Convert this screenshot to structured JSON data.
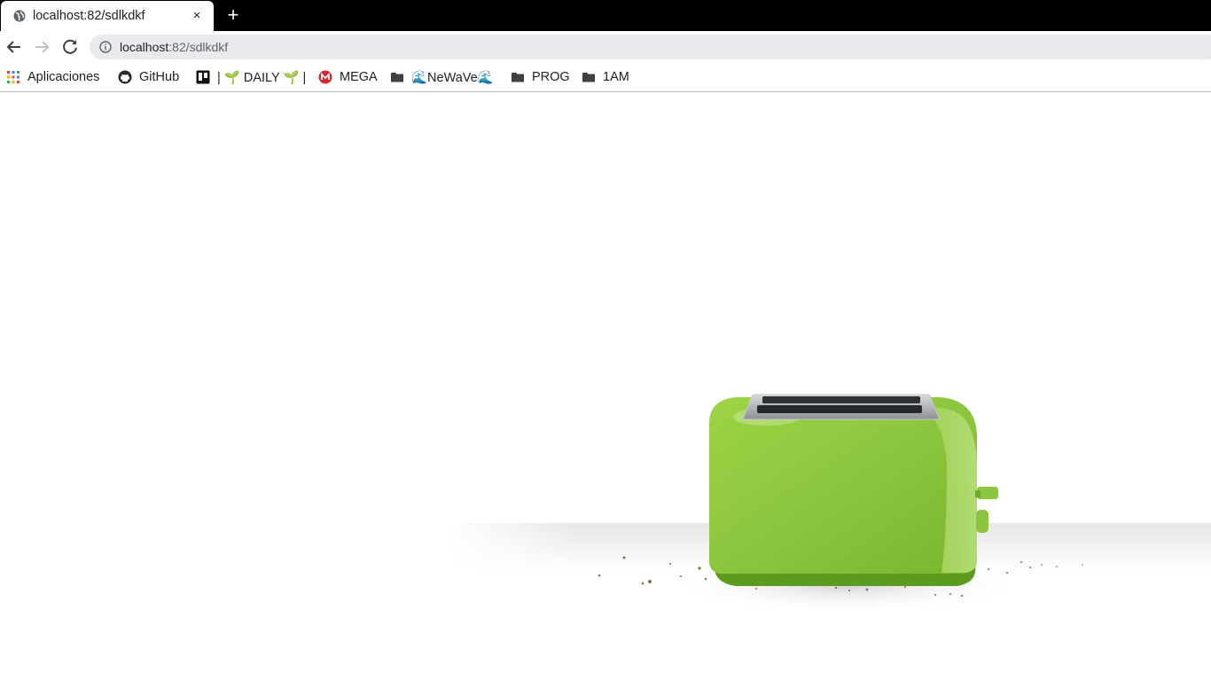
{
  "browser": {
    "tab": {
      "title": "localhost:82/sdlkdkf",
      "close_glyph": "×",
      "favicon": "globe-icon"
    },
    "new_tab_glyph": "+",
    "address": {
      "host": "localhost",
      "path": ":82/sdlkdkf"
    }
  },
  "bookmarks": [
    {
      "label": "Aplicaciones",
      "icon": "apps-grid-icon"
    },
    {
      "label": "GitHub",
      "icon": "github-icon"
    },
    {
      "label": "| 🌱 DAILY 🌱 |",
      "icon": "trello-icon"
    },
    {
      "label": "MEGA",
      "icon": "mega-icon"
    },
    {
      "label": "🌊NeWaVe🌊",
      "icon": "folder-icon"
    },
    {
      "label": "PROG",
      "icon": "folder-icon"
    },
    {
      "label": "1AM",
      "icon": "folder-icon"
    }
  ],
  "page": {
    "illustration": "green-toaster-illustration",
    "colors": {
      "toaster_body": "#8cc63f",
      "toaster_base": "#5d9b20",
      "slot_metal": "#9ea3a8"
    }
  }
}
